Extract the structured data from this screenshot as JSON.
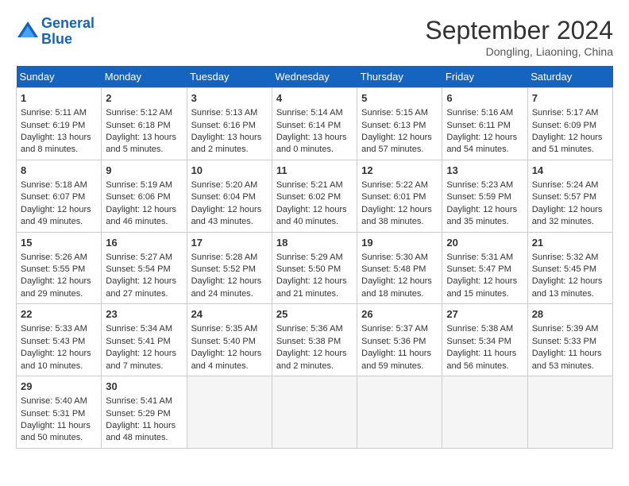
{
  "header": {
    "logo_line1": "General",
    "logo_line2": "Blue",
    "month_title": "September 2024",
    "subtitle": "Dongling, Liaoning, China"
  },
  "days_of_week": [
    "Sunday",
    "Monday",
    "Tuesday",
    "Wednesday",
    "Thursday",
    "Friday",
    "Saturday"
  ],
  "weeks": [
    [
      {
        "day": "1",
        "lines": [
          "Sunrise: 5:11 AM",
          "Sunset: 6:19 PM",
          "Daylight: 13 hours",
          "and 8 minutes."
        ]
      },
      {
        "day": "2",
        "lines": [
          "Sunrise: 5:12 AM",
          "Sunset: 6:18 PM",
          "Daylight: 13 hours",
          "and 5 minutes."
        ]
      },
      {
        "day": "3",
        "lines": [
          "Sunrise: 5:13 AM",
          "Sunset: 6:16 PM",
          "Daylight: 13 hours",
          "and 2 minutes."
        ]
      },
      {
        "day": "4",
        "lines": [
          "Sunrise: 5:14 AM",
          "Sunset: 6:14 PM",
          "Daylight: 13 hours",
          "and 0 minutes."
        ]
      },
      {
        "day": "5",
        "lines": [
          "Sunrise: 5:15 AM",
          "Sunset: 6:13 PM",
          "Daylight: 12 hours",
          "and 57 minutes."
        ]
      },
      {
        "day": "6",
        "lines": [
          "Sunrise: 5:16 AM",
          "Sunset: 6:11 PM",
          "Daylight: 12 hours",
          "and 54 minutes."
        ]
      },
      {
        "day": "7",
        "lines": [
          "Sunrise: 5:17 AM",
          "Sunset: 6:09 PM",
          "Daylight: 12 hours",
          "and 51 minutes."
        ]
      }
    ],
    [
      {
        "day": "8",
        "lines": [
          "Sunrise: 5:18 AM",
          "Sunset: 6:07 PM",
          "Daylight: 12 hours",
          "and 49 minutes."
        ]
      },
      {
        "day": "9",
        "lines": [
          "Sunrise: 5:19 AM",
          "Sunset: 6:06 PM",
          "Daylight: 12 hours",
          "and 46 minutes."
        ]
      },
      {
        "day": "10",
        "lines": [
          "Sunrise: 5:20 AM",
          "Sunset: 6:04 PM",
          "Daylight: 12 hours",
          "and 43 minutes."
        ]
      },
      {
        "day": "11",
        "lines": [
          "Sunrise: 5:21 AM",
          "Sunset: 6:02 PM",
          "Daylight: 12 hours",
          "and 40 minutes."
        ]
      },
      {
        "day": "12",
        "lines": [
          "Sunrise: 5:22 AM",
          "Sunset: 6:01 PM",
          "Daylight: 12 hours",
          "and 38 minutes."
        ]
      },
      {
        "day": "13",
        "lines": [
          "Sunrise: 5:23 AM",
          "Sunset: 5:59 PM",
          "Daylight: 12 hours",
          "and 35 minutes."
        ]
      },
      {
        "day": "14",
        "lines": [
          "Sunrise: 5:24 AM",
          "Sunset: 5:57 PM",
          "Daylight: 12 hours",
          "and 32 minutes."
        ]
      }
    ],
    [
      {
        "day": "15",
        "lines": [
          "Sunrise: 5:26 AM",
          "Sunset: 5:55 PM",
          "Daylight: 12 hours",
          "and 29 minutes."
        ]
      },
      {
        "day": "16",
        "lines": [
          "Sunrise: 5:27 AM",
          "Sunset: 5:54 PM",
          "Daylight: 12 hours",
          "and 27 minutes."
        ]
      },
      {
        "day": "17",
        "lines": [
          "Sunrise: 5:28 AM",
          "Sunset: 5:52 PM",
          "Daylight: 12 hours",
          "and 24 minutes."
        ]
      },
      {
        "day": "18",
        "lines": [
          "Sunrise: 5:29 AM",
          "Sunset: 5:50 PM",
          "Daylight: 12 hours",
          "and 21 minutes."
        ]
      },
      {
        "day": "19",
        "lines": [
          "Sunrise: 5:30 AM",
          "Sunset: 5:48 PM",
          "Daylight: 12 hours",
          "and 18 minutes."
        ]
      },
      {
        "day": "20",
        "lines": [
          "Sunrise: 5:31 AM",
          "Sunset: 5:47 PM",
          "Daylight: 12 hours",
          "and 15 minutes."
        ]
      },
      {
        "day": "21",
        "lines": [
          "Sunrise: 5:32 AM",
          "Sunset: 5:45 PM",
          "Daylight: 12 hours",
          "and 13 minutes."
        ]
      }
    ],
    [
      {
        "day": "22",
        "lines": [
          "Sunrise: 5:33 AM",
          "Sunset: 5:43 PM",
          "Daylight: 12 hours",
          "and 10 minutes."
        ]
      },
      {
        "day": "23",
        "lines": [
          "Sunrise: 5:34 AM",
          "Sunset: 5:41 PM",
          "Daylight: 12 hours",
          "and 7 minutes."
        ]
      },
      {
        "day": "24",
        "lines": [
          "Sunrise: 5:35 AM",
          "Sunset: 5:40 PM",
          "Daylight: 12 hours",
          "and 4 minutes."
        ]
      },
      {
        "day": "25",
        "lines": [
          "Sunrise: 5:36 AM",
          "Sunset: 5:38 PM",
          "Daylight: 12 hours",
          "and 2 minutes."
        ]
      },
      {
        "day": "26",
        "lines": [
          "Sunrise: 5:37 AM",
          "Sunset: 5:36 PM",
          "Daylight: 11 hours",
          "and 59 minutes."
        ]
      },
      {
        "day": "27",
        "lines": [
          "Sunrise: 5:38 AM",
          "Sunset: 5:34 PM",
          "Daylight: 11 hours",
          "and 56 minutes."
        ]
      },
      {
        "day": "28",
        "lines": [
          "Sunrise: 5:39 AM",
          "Sunset: 5:33 PM",
          "Daylight: 11 hours",
          "and 53 minutes."
        ]
      }
    ],
    [
      {
        "day": "29",
        "lines": [
          "Sunrise: 5:40 AM",
          "Sunset: 5:31 PM",
          "Daylight: 11 hours",
          "and 50 minutes."
        ]
      },
      {
        "day": "30",
        "lines": [
          "Sunrise: 5:41 AM",
          "Sunset: 5:29 PM",
          "Daylight: 11 hours",
          "and 48 minutes."
        ]
      },
      null,
      null,
      null,
      null,
      null
    ]
  ]
}
